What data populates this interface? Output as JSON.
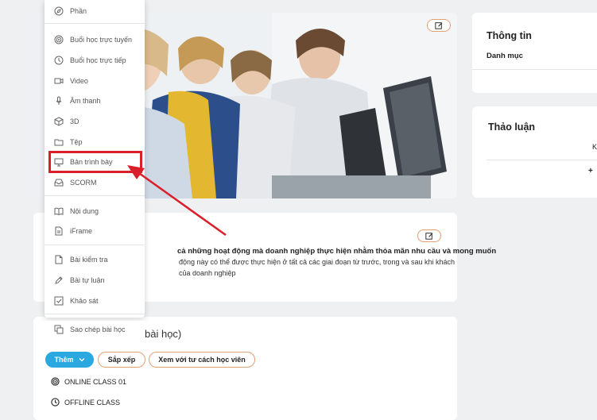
{
  "menu": {
    "items": [
      {
        "label": "Phần",
        "icon": "compass-icon"
      },
      {
        "label": "Buổi học trực tuyến",
        "icon": "online-target-icon"
      },
      {
        "label": "Buổi học trực tiếp",
        "icon": "clock-icon"
      },
      {
        "label": "Video",
        "icon": "video-icon"
      },
      {
        "label": "Âm thanh",
        "icon": "microphone-icon"
      },
      {
        "label": "3D",
        "icon": "cube-icon"
      },
      {
        "label": "Tệp",
        "icon": "folder-icon"
      },
      {
        "label": "Bản trình bày",
        "icon": "monitor-icon"
      },
      {
        "label": "SCORM",
        "icon": "inbox-icon"
      },
      {
        "label": "Nội dung",
        "icon": "book-icon"
      },
      {
        "label": "iFrame",
        "icon": "document-icon"
      },
      {
        "label": "Bài kiểm tra",
        "icon": "file-icon"
      },
      {
        "label": "Bài tự luận",
        "icon": "pen-icon"
      },
      {
        "label": "Khảo sát",
        "icon": "checkbox-icon"
      },
      {
        "label": "Sao chép bài học",
        "icon": "copy-icon"
      }
    ]
  },
  "description": {
    "line1": "cả những hoạt động mà doanh nghiệp thực hiện nhằm thỏa mãn nhu cầu và mong muốn",
    "line2": "động này có thể được thực hiện ở tất cả các giai đoạn từ trước, trong và sau khi khách",
    "line3": "của doanh nghiệp"
  },
  "lessons": {
    "title": "bài học)",
    "add_label": "Thêm",
    "sort_label": "Sắp xếp",
    "view_label": "Xem với tư cách học viên",
    "rows": [
      "ONLINE CLASS 01",
      "OFFLINE CLASS"
    ]
  },
  "info": {
    "title": "Thông tin",
    "category": "Danh mục"
  },
  "discussion": {
    "title": "Thảo luận",
    "truncated": "K",
    "plus": "+"
  },
  "colors": {
    "accent": "#2aa8df",
    "highlight": "#d9202a",
    "border": "#e3a073"
  }
}
